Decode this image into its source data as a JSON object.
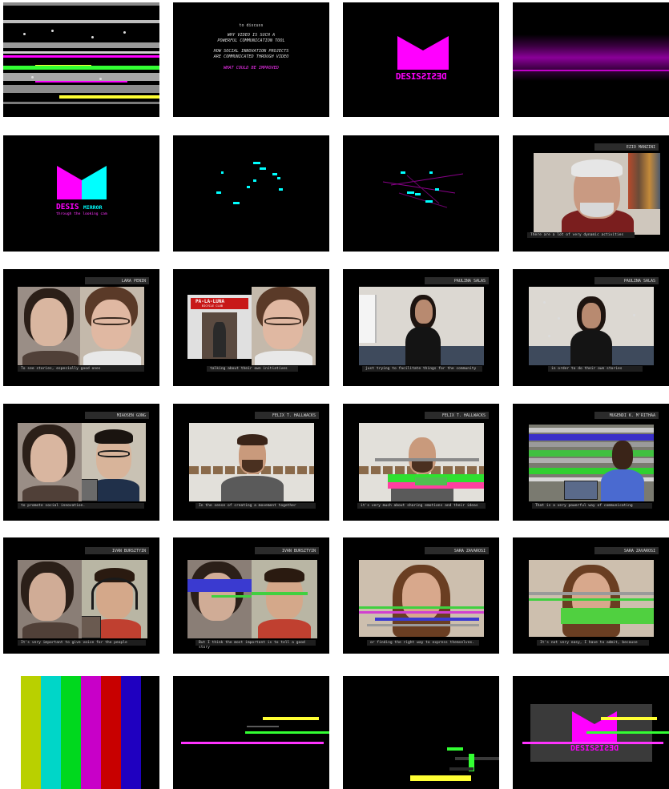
{
  "intro": {
    "kicker": "to discuss",
    "line1": "WHY VIDEO IS SUCH A",
    "line2": "POWERFUL COMMUNICATION TOOL",
    "line3": "HOW SOCIAL INNOVATION PROJECTS",
    "line4": "ARE COMMUNICATED THROUGH VIDEO",
    "highlight": "WHAT COULD BE IMPROVED"
  },
  "logo": {
    "mirrored_wordmark": "DESISDESIS",
    "brand_main": "DESIS",
    "brand_sub": "MIRROR",
    "tagline": "through the looking cam"
  },
  "interviews": [
    {
      "name": "EZIO MANZINI",
      "caption": "There are a lot of very dynamic activities"
    },
    {
      "name": "LARA PENIN",
      "caption": "To see stories, especially good ones"
    },
    {
      "name": "",
      "caption": "talking about their own initiatives",
      "sign": "PA-LA-LUNA",
      "sign_sub": "BICYCLE CLUB"
    },
    {
      "name": "PAULINA SALAS",
      "caption": "just trying to facilitate things for the community"
    },
    {
      "name": "PAULINA SALAS",
      "caption": "in order to do their own stories"
    },
    {
      "name": "MIAOSEN GONG",
      "caption": "to promote social innovation."
    },
    {
      "name": "FELIX T. HALLWACKS",
      "caption": "In the sense of creating a movement together"
    },
    {
      "name": "FELIX T. HALLWACKS",
      "caption": "it's very much about sharing emotions and their ideas"
    },
    {
      "name": "MUGENDI K. M'RITHAA",
      "caption": "That is a very powerful way of communicating"
    },
    {
      "name": "IVAN BURSZTYIN",
      "caption": "It's very important to give voice for the people"
    },
    {
      "name": "IVAN BURSZTYIN",
      "caption": "But I think the most important is to tell a good story"
    },
    {
      "name": "SARA ZAVAROSI",
      "caption": "or finding the right way to express themselves."
    },
    {
      "name": "SARA ZAVAROSI",
      "caption": "It's not very easy, I have to admit, because"
    }
  ],
  "colors": {
    "magenta": "#ff00ff",
    "cyan": "#00ffff",
    "green": "#33ff33",
    "yellow": "#ffff33",
    "bars": [
      "#b9d000",
      "#00d6c8",
      "#00d81e",
      "#c800c8",
      "#c80000",
      "#1f00c0"
    ]
  }
}
